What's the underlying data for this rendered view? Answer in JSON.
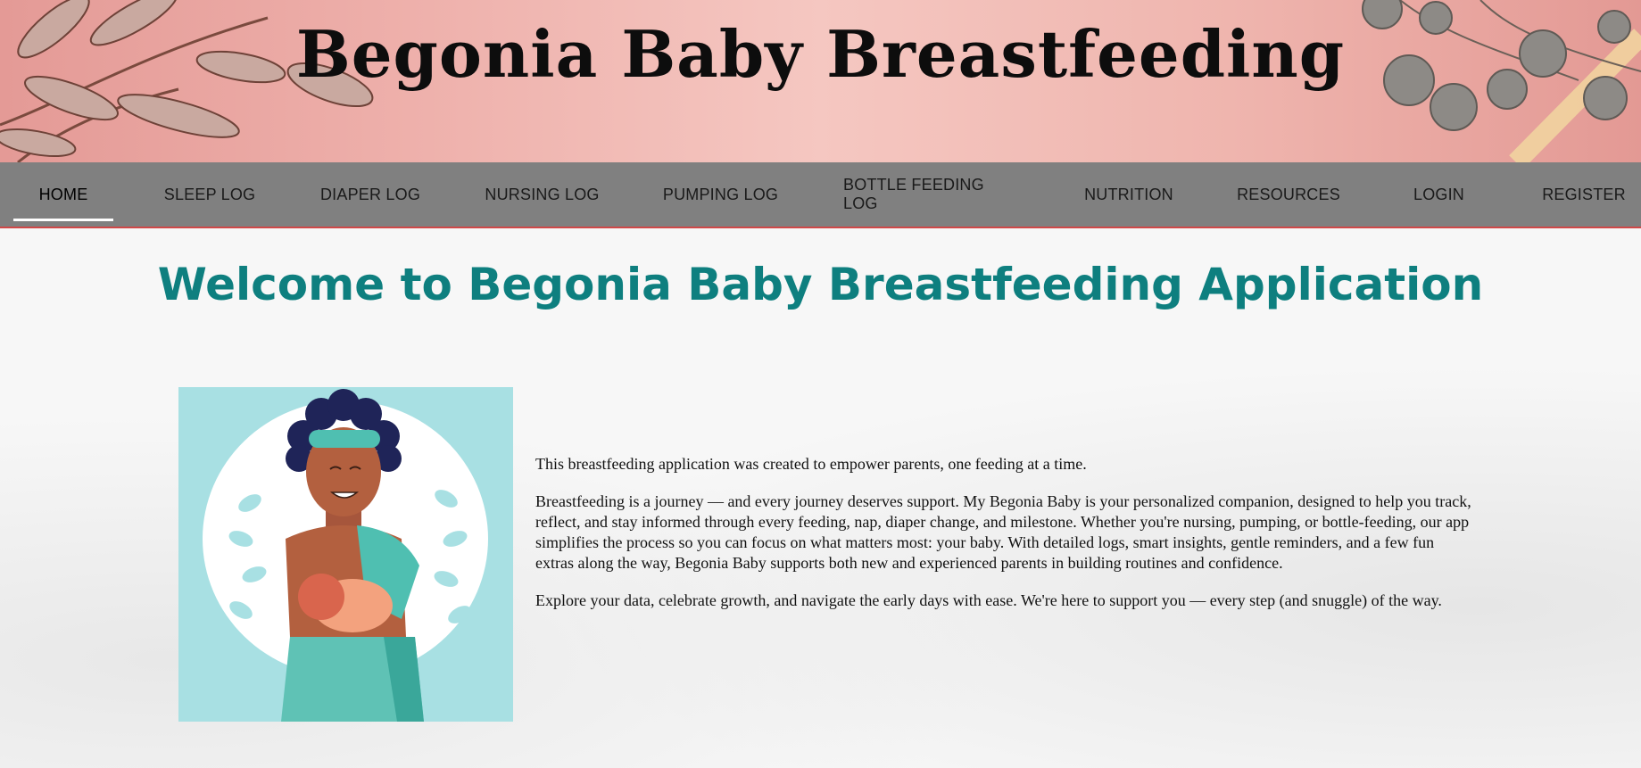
{
  "header": {
    "site_title": "Begonia Baby Breastfeeding"
  },
  "nav": {
    "items": [
      {
        "label": "HOME",
        "active": true
      },
      {
        "label": "SLEEP LOG"
      },
      {
        "label": "DIAPER LOG"
      },
      {
        "label": "NURSING LOG"
      },
      {
        "label": "PUMPING LOG"
      },
      {
        "label": "BOTTLE FEEDING LOG"
      },
      {
        "label": "NUTRITION"
      },
      {
        "label": "RESOURCES"
      },
      {
        "label": "LOGIN"
      },
      {
        "label": "REGISTER"
      }
    ]
  },
  "main": {
    "heading": "Welcome to Begonia Baby Breastfeeding Application",
    "paragraphs": [
      "This breastfeeding application was created to empower parents, one feeding at a time.",
      "Breastfeeding is a journey — and every journey deserves support. My Begonia Baby is your personalized companion, designed to help you track, reflect, and stay informed through every feeding, nap, diaper change, and milestone. Whether you're nursing, pumping, or bottle-feeding, our app simplifies the process so you can focus on what matters most: your baby. With detailed logs, smart insights, gentle reminders, and a few fun extras along the way, Begonia Baby supports both new and experienced parents in building routines and confidence.",
      "Explore your data, celebrate growth, and navigate the early days with ease. We're here to support you — every step (and snuggle) of the way."
    ]
  },
  "colors": {
    "nav_bg": "#808080",
    "heading": "#0e7f7f",
    "illustration_bg": "#a8e0e3"
  }
}
